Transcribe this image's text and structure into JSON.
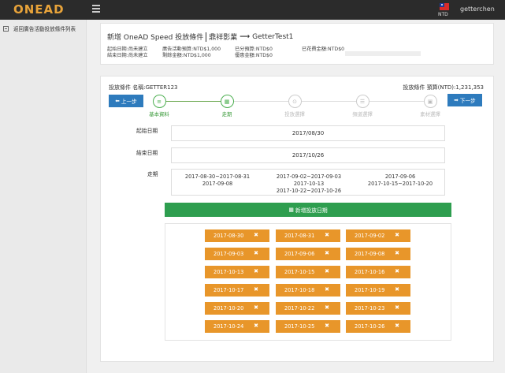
{
  "topbar": {
    "logo": "ONEAD",
    "currency": "NTD",
    "username": "getterchen"
  },
  "sidebar": {
    "back_label": "返回廣告活動投放條件列表"
  },
  "summary": {
    "title_part1": "新增 OneAD Speed 投放條件",
    "title_part2": "鼎祥影業",
    "title_part3": "GetterTest1",
    "start_status": "起始日期:尚未建立",
    "end_status": "結束日期:尚未建立",
    "campaign_budget": "廣告活動預算:NTD$1,000",
    "remaining_budget": "剩餘金額:NTD$1,000",
    "allocated_budget": "已分預算:NTD$0",
    "discount_amount": "優惠金額:NTD$0",
    "spent_amount": "已花費金額:NTD$0"
  },
  "main": {
    "condition_name": "投放條件 名稱:GETTER123",
    "condition_budget": "投放條件 預算(NTD):1,231,353",
    "prev_label": "上一步",
    "next_label": "下一步",
    "steps": [
      {
        "label": "基本資料",
        "icon": "list-icon",
        "glyph": "≡",
        "status": "done"
      },
      {
        "label": "走期",
        "icon": "calendar-icon",
        "glyph": "▦",
        "status": "current"
      },
      {
        "label": "投放選擇",
        "icon": "target-icon",
        "glyph": "⊙",
        "status": "todo"
      },
      {
        "label": "頻道選擇",
        "icon": "database-icon",
        "glyph": "☰",
        "status": "todo"
      },
      {
        "label": "素材選擇",
        "icon": "image-icon",
        "glyph": "▣",
        "status": "todo"
      }
    ],
    "start_label": "起始日期",
    "start_value": "2017/08/30",
    "end_label": "結束日期",
    "end_value": "2017/10/26",
    "period_label": "走期",
    "periods": [
      [
        "2017-08-30~2017-08-31",
        "2017-09-08"
      ],
      [
        "2017-09-02~2017-09-03",
        "2017-10-13",
        "2017-10-22~2017-10-26"
      ],
      [
        "2017-09-06",
        "2017-10-15~2017-10-20"
      ]
    ],
    "add_date_label": "新增投放日期",
    "date_tags": [
      "2017-08-30",
      "2017-08-31",
      "2017-09-02",
      "2017-09-03",
      "2017-09-06",
      "2017-09-08",
      "2017-10-13",
      "2017-10-15",
      "2017-10-16",
      "2017-10-17",
      "2017-10-18",
      "2017-10-19",
      "2017-10-20",
      "2017-10-22",
      "2017-10-23",
      "2017-10-24",
      "2017-10-25",
      "2017-10-26"
    ]
  },
  "colors": {
    "accent": "#e8962a",
    "primary": "#2e7bbd",
    "success": "#2e9e4f",
    "topbar": "#2b2b2b"
  }
}
